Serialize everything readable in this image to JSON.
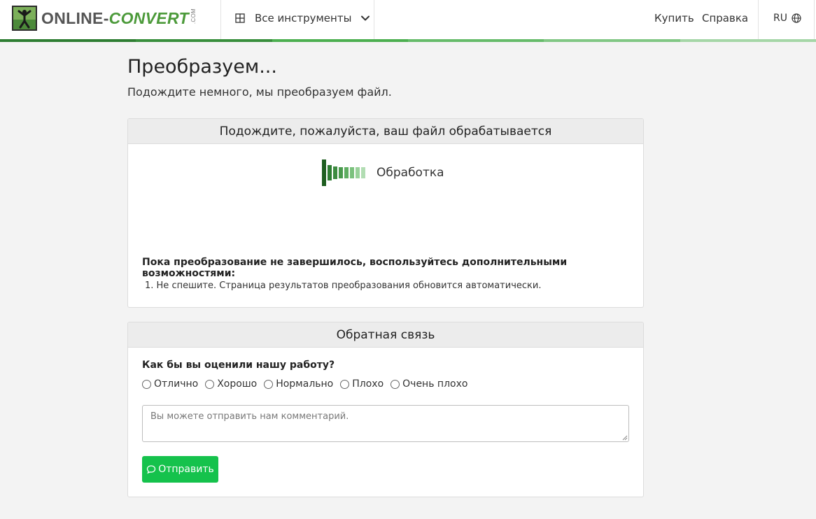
{
  "header": {
    "logo_text_part1": "ONLINE-",
    "logo_text_part2": "CONVERT",
    "logo_text_part3": ".COM",
    "tools_label": "Все инструменты",
    "buy_label": "Купить",
    "help_label": "Справка",
    "lang_label": "RU"
  },
  "stripe_colors": [
    "#2e7d32",
    "#388e3c",
    "#4caf50",
    "#66bb6a",
    "#81c784",
    "#a5d6a7"
  ],
  "main": {
    "title": "Преобразуем...",
    "subtitle": "Подождите немного, мы преобразуем файл."
  },
  "processing_card": {
    "header": "Подождите, пожалуйста, ваш файл обрабатывается",
    "status_label": "Обработка",
    "hint_title": "Пока преобразование не завершилось, воспользуйтесь дополнительными возможностями:",
    "hint_item_1": "1. Не спешите. Страница результатов преобразования обновится автоматически."
  },
  "feedback_card": {
    "header": "Обратная связь",
    "question": "Как бы вы оценили нашу работу?",
    "options": [
      "Отлично",
      "Хорошо",
      "Нормально",
      "Плохо",
      "Очень плохо"
    ],
    "comment_placeholder": "Вы можете отправить нам комментарий.",
    "send_label": "Отправить"
  },
  "colors": {
    "accent_green": "#15c24c",
    "brand_green": "#4c9a3a"
  }
}
